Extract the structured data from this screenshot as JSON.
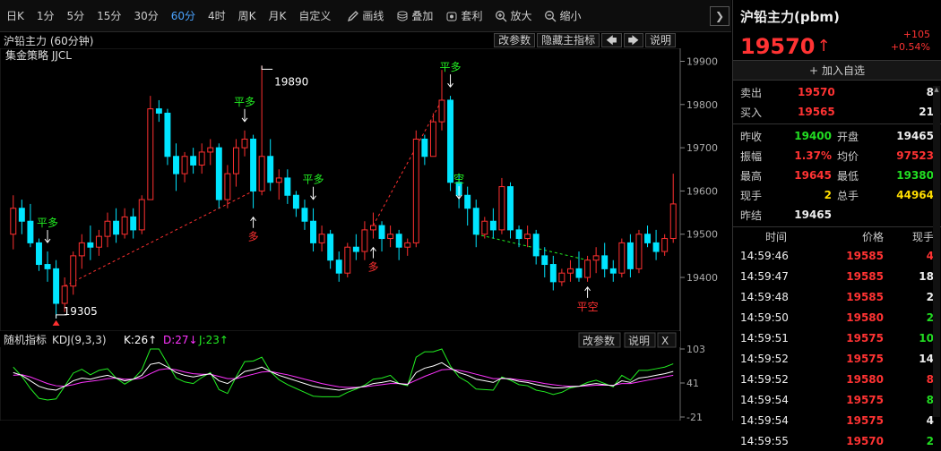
{
  "toolbar": {
    "periods": [
      {
        "label": "日K",
        "active": false
      },
      {
        "label": "1分",
        "active": false
      },
      {
        "label": "5分",
        "active": false
      },
      {
        "label": "15分",
        "active": false
      },
      {
        "label": "30分",
        "active": false
      },
      {
        "label": "60分",
        "active": true
      },
      {
        "label": "4时",
        "active": false
      },
      {
        "label": "周K",
        "active": false
      },
      {
        "label": "月K",
        "active": false
      },
      {
        "label": "自定义",
        "active": false
      }
    ],
    "tools": [
      {
        "label": "画线",
        "icon": "pencil-icon"
      },
      {
        "label": "叠加",
        "icon": "stack-icon"
      },
      {
        "label": "套利",
        "icon": "arbitrage-icon"
      },
      {
        "label": "放大",
        "icon": "zoom-in-icon"
      },
      {
        "label": "缩小",
        "icon": "zoom-out-icon"
      }
    ]
  },
  "main_panel": {
    "title": "沪铅主力 (60分钟)",
    "strategy": "集金策略 JJCL",
    "buttons": {
      "params": "改参数",
      "hide": "隐藏主指标",
      "explain": "说明"
    },
    "price_ticks": [
      19900,
      19800,
      19700,
      19600,
      19500,
      19400
    ],
    "annotations": {
      "high": "19890",
      "low": "19305"
    },
    "signals": [
      {
        "text": "平多",
        "type": "flat",
        "i": 4
      },
      {
        "text": "平多",
        "type": "flat",
        "i": 27
      },
      {
        "text": "多",
        "type": "buy",
        "i": 28
      },
      {
        "text": "平多",
        "type": "flat",
        "i": 35
      },
      {
        "text": "多",
        "type": "buy",
        "i": 42
      },
      {
        "text": "平多",
        "type": "flat",
        "i": 51
      },
      {
        "text": "空",
        "type": "short",
        "i": 52
      },
      {
        "text": "平空",
        "type": "flatshort",
        "i": 67
      }
    ]
  },
  "sub_panel": {
    "name": "随机指标",
    "kdj_label": "KDJ(9,3,3)",
    "k_text": "K:26↑",
    "d_text": "D:27↓",
    "j_text": "J:23↑",
    "buttons": {
      "params": "改参数",
      "explain": "说明",
      "close": "X"
    },
    "y_ticks": [
      "103",
      "41",
      "-21"
    ]
  },
  "chart_data": {
    "type": "candlestick",
    "title": "沪铅主力 (60分钟)",
    "ylim": [
      19280,
      19930
    ],
    "candles": [
      [
        19500,
        19590,
        19465,
        19560
      ],
      [
        19560,
        19580,
        19500,
        19530
      ],
      [
        19530,
        19570,
        19470,
        19480
      ],
      [
        19480,
        19490,
        19415,
        19430
      ],
      [
        19430,
        19460,
        19390,
        19420
      ],
      [
        19420,
        19440,
        19305,
        19340
      ],
      [
        19340,
        19400,
        19320,
        19380
      ],
      [
        19380,
        19460,
        19360,
        19450
      ],
      [
        19450,
        19500,
        19420,
        19480
      ],
      [
        19480,
        19520,
        19440,
        19470
      ],
      [
        19470,
        19510,
        19450,
        19495
      ],
      [
        19495,
        19550,
        19470,
        19530
      ],
      [
        19530,
        19560,
        19480,
        19500
      ],
      [
        19500,
        19560,
        19490,
        19540
      ],
      [
        19540,
        19560,
        19490,
        19510
      ],
      [
        19510,
        19590,
        19500,
        19580
      ],
      [
        19580,
        19820,
        19580,
        19790
      ],
      [
        19790,
        19810,
        19760,
        19780
      ],
      [
        19780,
        19790,
        19660,
        19680
      ],
      [
        19680,
        19710,
        19600,
        19640
      ],
      [
        19640,
        19690,
        19620,
        19680
      ],
      [
        19680,
        19700,
        19640,
        19660
      ],
      [
        19660,
        19710,
        19640,
        19690
      ],
      [
        19690,
        19720,
        19660,
        19700
      ],
      [
        19700,
        19710,
        19560,
        19580
      ],
      [
        19580,
        19660,
        19560,
        19640
      ],
      [
        19640,
        19720,
        19610,
        19700
      ],
      [
        19700,
        19740,
        19680,
        19720
      ],
      [
        19720,
        19730,
        19560,
        19600
      ],
      [
        19600,
        19890,
        19590,
        19680
      ],
      [
        19680,
        19720,
        19600,
        19620
      ],
      [
        19620,
        19650,
        19580,
        19630
      ],
      [
        19630,
        19650,
        19570,
        19590
      ],
      [
        19590,
        19600,
        19540,
        19560
      ],
      [
        19560,
        19580,
        19510,
        19530
      ],
      [
        19530,
        19560,
        19460,
        19480
      ],
      [
        19480,
        19520,
        19460,
        19500
      ],
      [
        19500,
        19510,
        19420,
        19440
      ],
      [
        19440,
        19460,
        19390,
        19410
      ],
      [
        19410,
        19480,
        19400,
        19470
      ],
      [
        19470,
        19500,
        19440,
        19460
      ],
      [
        19460,
        19530,
        19440,
        19510
      ],
      [
        19510,
        19550,
        19490,
        19520
      ],
      [
        19520,
        19530,
        19460,
        19490
      ],
      [
        19490,
        19520,
        19470,
        19500
      ],
      [
        19500,
        19510,
        19440,
        19470
      ],
      [
        19470,
        19490,
        19450,
        19480
      ],
      [
        19480,
        19740,
        19470,
        19720
      ],
      [
        19720,
        19730,
        19660,
        19680
      ],
      [
        19680,
        19780,
        19680,
        19760
      ],
      [
        19760,
        19880,
        19740,
        19810
      ],
      [
        19810,
        19820,
        19600,
        19620
      ],
      [
        19620,
        19640,
        19560,
        19590
      ],
      [
        19590,
        19610,
        19520,
        19560
      ],
      [
        19560,
        19580,
        19470,
        19500
      ],
      [
        19500,
        19540,
        19490,
        19530
      ],
      [
        19530,
        19560,
        19490,
        19510
      ],
      [
        19510,
        19630,
        19500,
        19610
      ],
      [
        19610,
        19620,
        19490,
        19510
      ],
      [
        19510,
        19520,
        19470,
        19490
      ],
      [
        19490,
        19520,
        19470,
        19500
      ],
      [
        19500,
        19510,
        19430,
        19450
      ],
      [
        19450,
        19470,
        19400,
        19430
      ],
      [
        19430,
        19450,
        19370,
        19390
      ],
      [
        19390,
        19420,
        19380,
        19410
      ],
      [
        19410,
        19440,
        19390,
        19420
      ],
      [
        19420,
        19460,
        19390,
        19400
      ],
      [
        19400,
        19450,
        19390,
        19440
      ],
      [
        19440,
        19470,
        19410,
        19450
      ],
      [
        19450,
        19480,
        19400,
        19420
      ],
      [
        19420,
        19440,
        19390,
        19410
      ],
      [
        19410,
        19490,
        19400,
        19480
      ],
      [
        19480,
        19500,
        19400,
        19420
      ],
      [
        19420,
        19510,
        19410,
        19500
      ],
      [
        19500,
        19520,
        19470,
        19480
      ],
      [
        19480,
        19510,
        19440,
        19460
      ],
      [
        19460,
        19500,
        19450,
        19490
      ],
      [
        19490,
        19640,
        19480,
        19570
      ]
    ],
    "kdj": {
      "k": [
        60,
        55,
        45,
        35,
        30,
        28,
        35,
        45,
        50,
        48,
        52,
        55,
        50,
        45,
        48,
        55,
        75,
        78,
        70,
        60,
        55,
        52,
        55,
        58,
        45,
        40,
        50,
        62,
        65,
        70,
        62,
        55,
        50,
        45,
        40,
        35,
        32,
        30,
        28,
        30,
        32,
        35,
        40,
        42,
        45,
        40,
        38,
        60,
        68,
        72,
        78,
        68,
        60,
        55,
        48,
        45,
        42,
        50,
        48,
        44,
        42,
        38,
        35,
        32,
        32,
        34,
        35,
        38,
        40,
        38,
        36,
        45,
        42,
        50,
        52,
        55,
        58,
        62
      ],
      "d": [
        55,
        56,
        52,
        46,
        40,
        36,
        35,
        38,
        42,
        44,
        46,
        49,
        50,
        48,
        48,
        50,
        58,
        65,
        67,
        65,
        61,
        58,
        57,
        57,
        53,
        49,
        49,
        53,
        57,
        61,
        62,
        59,
        56,
        52,
        48,
        44,
        40,
        37,
        34,
        33,
        33,
        34,
        36,
        38,
        40,
        40,
        39,
        46,
        53,
        59,
        65,
        66,
        64,
        61,
        57,
        53,
        49,
        49,
        49,
        47,
        45,
        43,
        40,
        38,
        36,
        35,
        35,
        36,
        37,
        37,
        37,
        40,
        40,
        43,
        46,
        49,
        52,
        55
      ],
      "j": [
        70,
        53,
        31,
        13,
        10,
        12,
        35,
        59,
        66,
        56,
        64,
        67,
        50,
        39,
        48,
        65,
        109,
        104,
        76,
        50,
        43,
        40,
        51,
        60,
        29,
        22,
        52,
        80,
        81,
        88,
        62,
        47,
        38,
        31,
        24,
        17,
        16,
        16,
        16,
        24,
        30,
        37,
        48,
        50,
        55,
        40,
        36,
        88,
        98,
        98,
        104,
        72,
        52,
        43,
        30,
        29,
        28,
        52,
        46,
        38,
        36,
        28,
        25,
        20,
        24,
        32,
        35,
        42,
        46,
        40,
        34,
        55,
        46,
        64,
        64,
        67,
        70,
        76
      ]
    }
  },
  "quote": {
    "name": "沪铅主力(pbm)",
    "price": "19570",
    "arrow": "↑",
    "change": "+105",
    "pct": "+0.54%",
    "add_label": "加入自选",
    "ask_label": "卖出",
    "ask_price": "19570",
    "ask_vol": "8",
    "bid_label": "买入",
    "bid_price": "19565",
    "bid_vol": "21",
    "stats": [
      [
        {
          "l": "昨收",
          "v": "19400",
          "c": "green"
        },
        {
          "l": "开盘",
          "v": "19465",
          "c": "white"
        }
      ],
      [
        {
          "l": "振幅",
          "v": "1.37%",
          "c": "red"
        },
        {
          "l": "均价",
          "v": "97523",
          "c": "red"
        }
      ],
      [
        {
          "l": "最高",
          "v": "19645",
          "c": "red"
        },
        {
          "l": "最低",
          "v": "19380",
          "c": "green"
        }
      ],
      [
        {
          "l": "现手",
          "v": "2",
          "c": "yellow"
        },
        {
          "l": "总手",
          "v": "44964",
          "c": "yellow"
        }
      ],
      [
        {
          "l": "昨结",
          "v": "19465",
          "c": "white"
        },
        {
          "l": "",
          "v": "",
          "c": "white"
        }
      ]
    ]
  },
  "ticks": {
    "headers": [
      "时间",
      "价格",
      "现手"
    ],
    "rows": [
      {
        "t": "14:59:46",
        "p": "19585",
        "v": "4",
        "pc": "red",
        "vc": "red"
      },
      {
        "t": "14:59:47",
        "p": "19585",
        "v": "18",
        "pc": "red",
        "vc": "white"
      },
      {
        "t": "14:59:48",
        "p": "19585",
        "v": "2",
        "pc": "red",
        "vc": "white"
      },
      {
        "t": "14:59:50",
        "p": "19580",
        "v": "2",
        "pc": "red",
        "vc": "green"
      },
      {
        "t": "14:59:51",
        "p": "19575",
        "v": "10",
        "pc": "red",
        "vc": "green"
      },
      {
        "t": "14:59:52",
        "p": "19575",
        "v": "14",
        "pc": "red",
        "vc": "white"
      },
      {
        "t": "14:59:52",
        "p": "19580",
        "v": "8",
        "pc": "red",
        "vc": "red"
      },
      {
        "t": "14:59:54",
        "p": "19575",
        "v": "8",
        "pc": "red",
        "vc": "green"
      },
      {
        "t": "14:59:54",
        "p": "19575",
        "v": "4",
        "pc": "red",
        "vc": "white"
      },
      {
        "t": "14:59:55",
        "p": "19570",
        "v": "2",
        "pc": "red",
        "vc": "green"
      }
    ]
  },
  "colors": {
    "up": "#ff3030",
    "down": "#00e5ff",
    "k": "#ffffff",
    "d": "#ff33ff",
    "j": "#22ee22",
    "signal": "#22ee22",
    "buy": "#ff3030"
  }
}
